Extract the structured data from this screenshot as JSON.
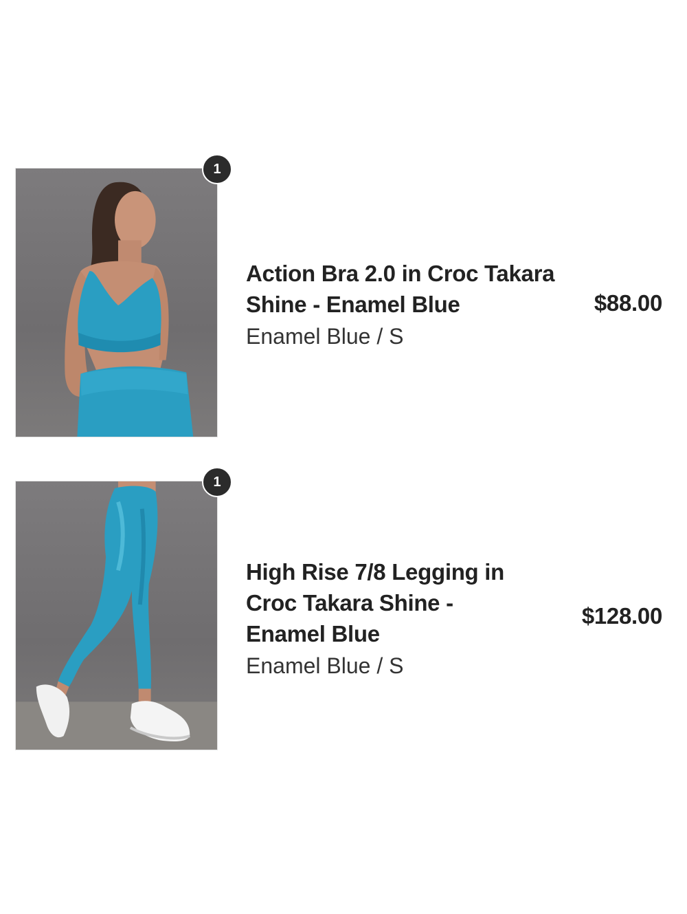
{
  "line_items": [
    {
      "quantity": "1",
      "title": "Action Bra 2.0 in Croc Takara Shine - Enamel Blue",
      "variant": "Enamel Blue / S",
      "price": "$88.00",
      "image_icon": "sports-bra-product-photo"
    },
    {
      "quantity": "1",
      "title": "High Rise 7/8 Legging in Croc Takara Shine - Enamel Blue",
      "variant": "Enamel Blue / S",
      "price": "$128.00",
      "image_icon": "legging-product-photo"
    }
  ],
  "colors": {
    "product_blue": "#2a9ec2",
    "badge_bg": "#2b2b2b",
    "photo_backdrop": "#767476"
  }
}
